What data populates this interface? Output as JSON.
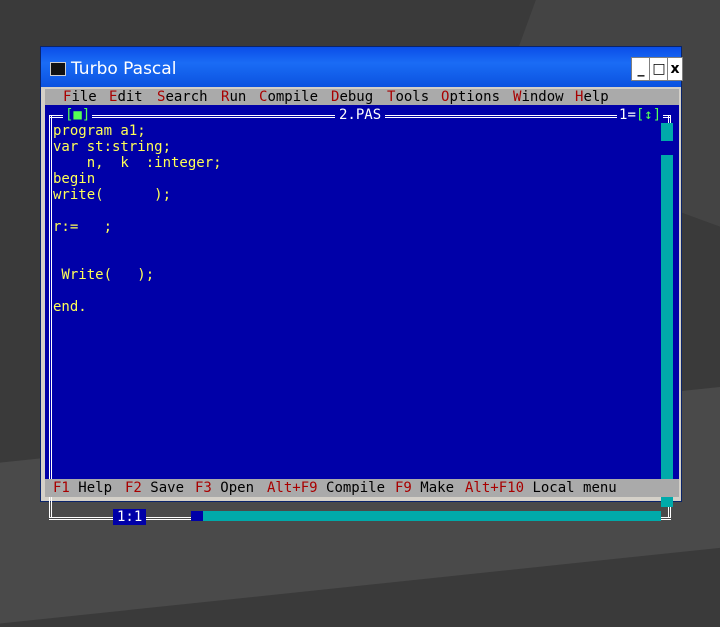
{
  "window": {
    "title": "Turbo Pascal"
  },
  "titlebar_buttons": {
    "minimize": "_",
    "maximize": "□",
    "close": "x"
  },
  "menu": {
    "items": [
      {
        "hotkey": "F",
        "rest": "ile"
      },
      {
        "hotkey": "E",
        "rest": "dit"
      },
      {
        "hotkey": "S",
        "rest": "earch"
      },
      {
        "hotkey": "R",
        "rest": "un"
      },
      {
        "hotkey": "C",
        "rest": "ompile"
      },
      {
        "hotkey": "D",
        "rest": "ebug"
      },
      {
        "hotkey": "T",
        "rest": "ools"
      },
      {
        "hotkey": "O",
        "rest": "ptions"
      },
      {
        "hotkey": "W",
        "rest": "indow"
      },
      {
        "hotkey": "H",
        "rest": "elp"
      }
    ]
  },
  "editor": {
    "file_name": "2.PAS",
    "window_number": "1",
    "close_box": "[■]",
    "zoom_box": "[↕]",
    "cursor_position": "1:1",
    "code": "program a1;\nvar st:string;\n    n,  k  :integer;\nbegin\nwrite(      );\n\nr:=   ;\n\n\n Write(   );\n\nend."
  },
  "statusbar": {
    "items": [
      {
        "key": "F1",
        "label": "Help"
      },
      {
        "key": "F2",
        "label": "Save"
      },
      {
        "key": "F3",
        "label": "Open"
      },
      {
        "key": "Alt+F9",
        "label": "Compile"
      },
      {
        "key": "F9",
        "label": "Make"
      },
      {
        "key": "Alt+F10",
        "label": "Local menu"
      }
    ]
  },
  "colors": {
    "titlebar": "#0a4ee8",
    "dos_blue": "#0000a8",
    "code_yellow": "#ffff55",
    "menu_gray": "#aaaaaa",
    "hotkey_red": "#a80000",
    "scroll_cyan": "#00aaaa"
  }
}
